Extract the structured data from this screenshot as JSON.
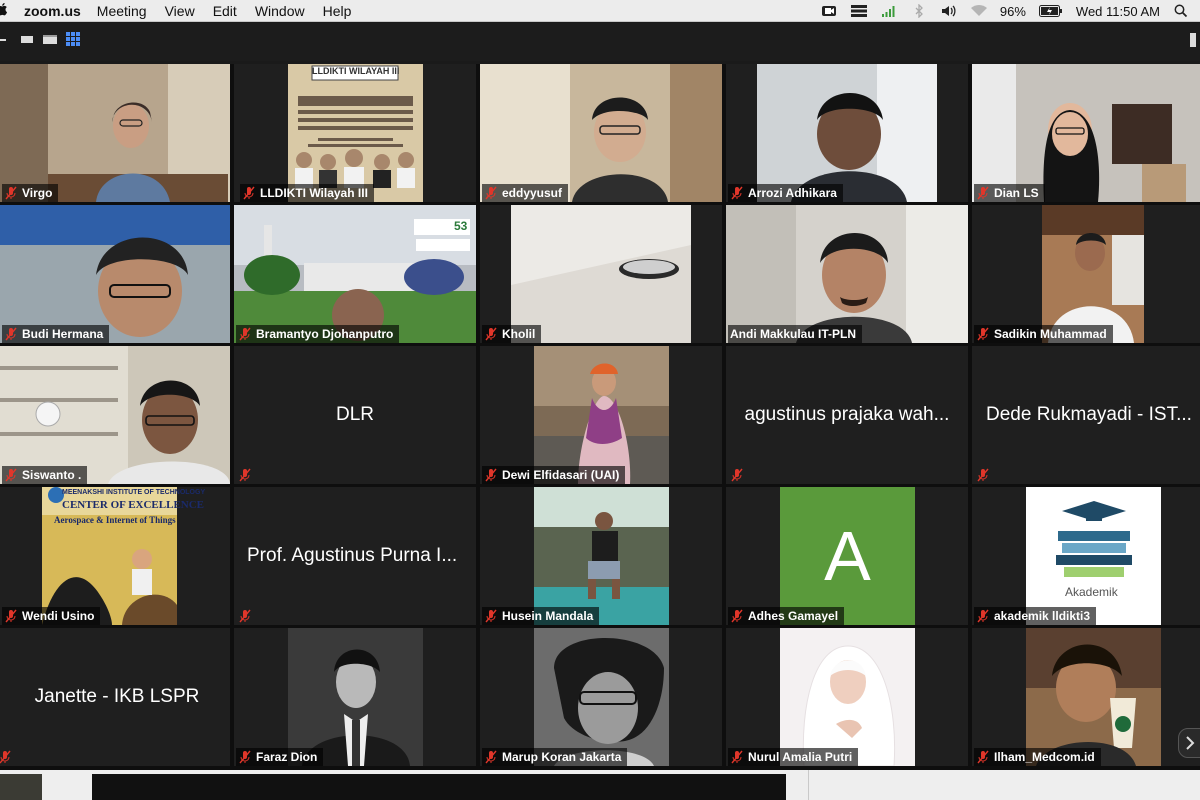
{
  "menubar": {
    "app_name": "zoom.us",
    "menus": [
      "Meeting",
      "View",
      "Edit",
      "Window",
      "Help"
    ],
    "battery": "96%",
    "clock": "Wed 11:50 AM"
  },
  "participants": [
    {
      "name": "Virgo",
      "video": true,
      "muted": true
    },
    {
      "name": "LLDIKTI Wilayah III",
      "video": true,
      "muted": true
    },
    {
      "name": "eddyyusuf",
      "video": true,
      "muted": true
    },
    {
      "name": "Arrozi Adhikara",
      "video": true,
      "muted": true
    },
    {
      "name": "Dian LS",
      "video": true,
      "muted": true
    },
    {
      "name": "Budi Hermana",
      "video": true,
      "muted": true
    },
    {
      "name": "Bramantyo Djohanputro",
      "video": true,
      "muted": true
    },
    {
      "name": "Kholil",
      "video": true,
      "muted": true
    },
    {
      "name": "Andi Makkulau IT-PLN",
      "video": true,
      "muted": false,
      "active_speaker": true
    },
    {
      "name": "Sadikin Muhammad",
      "video": true,
      "muted": true
    },
    {
      "name": "Siswanto .",
      "video": true,
      "muted": true
    },
    {
      "name": "DLR",
      "video": false,
      "muted": true
    },
    {
      "name": "Dewi Elfidasari (UAI)",
      "video": true,
      "muted": true
    },
    {
      "name": "agustinus prajaka wah...",
      "video": false,
      "muted": true
    },
    {
      "name": "Dede Rukmayadi - IST...",
      "video": false,
      "muted": true
    },
    {
      "name": "Wendi Usino",
      "video": true,
      "muted": true
    },
    {
      "name": "Prof. Agustinus Purna I...",
      "video": false,
      "muted": true
    },
    {
      "name": "Husein Mandala",
      "video": true,
      "muted": true
    },
    {
      "name": "Adhes Gamayel",
      "video": true,
      "muted": true
    },
    {
      "name": "akademik lldikti3",
      "video": true,
      "muted": true
    },
    {
      "name": "Janette - IKB LSPR",
      "video": false,
      "muted": true
    },
    {
      "name": "Faraz Dion",
      "video": true,
      "muted": true
    },
    {
      "name": "Marup Koran Jakarta",
      "video": true,
      "muted": true
    },
    {
      "name": "Nurul Amalia Putri",
      "video": true,
      "muted": true
    },
    {
      "name": "Ilham_Medcom.id",
      "video": true,
      "muted": true
    }
  ],
  "tile_text": {
    "lldikti_banner": "LLDIKTI WILAYAH III",
    "adhes_initial": "A",
    "akademik_caption": "Akademik",
    "wendi_banner_1": "MEENAKSHI INSTITUTE OF TECHNOLOGY",
    "wendi_banner_2": "CENTER OF EXCELLENCE",
    "wendi_banner_3": "Aerospace & Internet of Things",
    "bramantyo_badge": "53"
  },
  "colors": {
    "active_speaker_border": "#d6e06a",
    "mute_icon": "#e0362a",
    "adhes_avatar_bg": "#5a9a3b"
  }
}
